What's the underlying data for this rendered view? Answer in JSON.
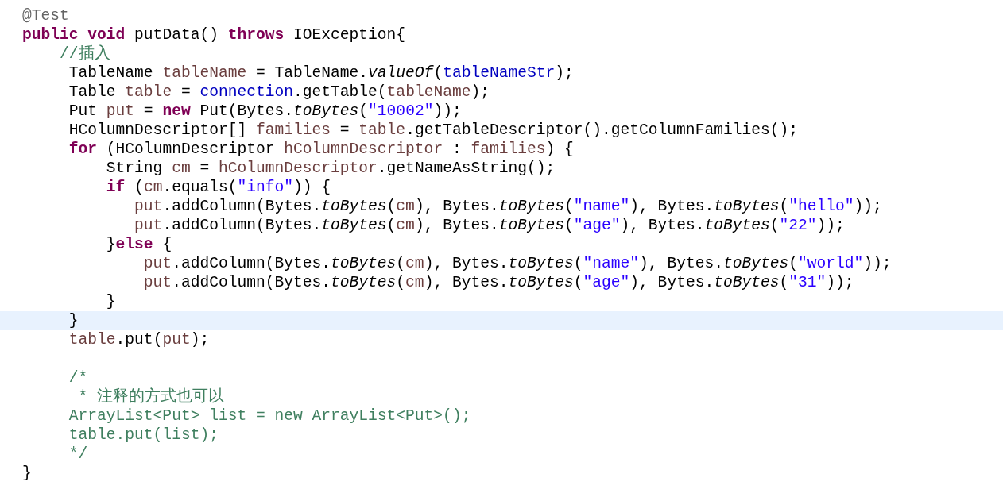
{
  "editor": {
    "lines": [
      {
        "highlighted": false,
        "tokens": [
          {
            "kind": "annotation",
            "text": "@Test"
          }
        ]
      },
      {
        "highlighted": false,
        "tokens": [
          {
            "kind": "keyword",
            "text": "public void"
          },
          {
            "kind": "plain",
            "text": " putData() "
          },
          {
            "kind": "keyword",
            "text": "throws"
          },
          {
            "kind": "plain",
            "text": " IOException{"
          }
        ]
      },
      {
        "highlighted": false,
        "tokens": [
          {
            "kind": "comment",
            "text": "    //插入"
          }
        ]
      },
      {
        "highlighted": false,
        "tokens": [
          {
            "kind": "plain",
            "text": "     TableName "
          },
          {
            "kind": "variable",
            "text": "tableName"
          },
          {
            "kind": "plain",
            "text": " = TableName."
          },
          {
            "kind": "static",
            "text": "valueOf"
          },
          {
            "kind": "plain",
            "text": "("
          },
          {
            "kind": "field",
            "text": "tableNameStr"
          },
          {
            "kind": "plain",
            "text": ");"
          }
        ]
      },
      {
        "highlighted": false,
        "tokens": [
          {
            "kind": "plain",
            "text": "     Table "
          },
          {
            "kind": "variable",
            "text": "table"
          },
          {
            "kind": "plain",
            "text": " = "
          },
          {
            "kind": "field",
            "text": "connection"
          },
          {
            "kind": "plain",
            "text": ".getTable("
          },
          {
            "kind": "variable",
            "text": "tableName"
          },
          {
            "kind": "plain",
            "text": ");"
          }
        ]
      },
      {
        "highlighted": false,
        "tokens": [
          {
            "kind": "plain",
            "text": "     Put "
          },
          {
            "kind": "variable",
            "text": "put"
          },
          {
            "kind": "plain",
            "text": " = "
          },
          {
            "kind": "keyword",
            "text": "new"
          },
          {
            "kind": "plain",
            "text": " Put(Bytes."
          },
          {
            "kind": "static",
            "text": "toBytes"
          },
          {
            "kind": "plain",
            "text": "("
          },
          {
            "kind": "string",
            "text": "\"10002\""
          },
          {
            "kind": "plain",
            "text": "));"
          }
        ]
      },
      {
        "highlighted": false,
        "tokens": [
          {
            "kind": "plain",
            "text": "     HColumnDescriptor[] "
          },
          {
            "kind": "variable",
            "text": "families"
          },
          {
            "kind": "plain",
            "text": " = "
          },
          {
            "kind": "variable",
            "text": "table"
          },
          {
            "kind": "plain",
            "text": ".getTableDescriptor().getColumnFamilies();"
          }
        ]
      },
      {
        "highlighted": false,
        "tokens": [
          {
            "kind": "keyword",
            "text": "     for"
          },
          {
            "kind": "plain",
            "text": " (HColumnDescriptor "
          },
          {
            "kind": "variable",
            "text": "hColumnDescriptor"
          },
          {
            "kind": "plain",
            "text": " : "
          },
          {
            "kind": "variable",
            "text": "families"
          },
          {
            "kind": "plain",
            "text": ") {"
          }
        ]
      },
      {
        "highlighted": false,
        "tokens": [
          {
            "kind": "plain",
            "text": "         String "
          },
          {
            "kind": "variable",
            "text": "cm"
          },
          {
            "kind": "plain",
            "text": " = "
          },
          {
            "kind": "variable",
            "text": "hColumnDescriptor"
          },
          {
            "kind": "plain",
            "text": ".getNameAsString();"
          }
        ]
      },
      {
        "highlighted": false,
        "tokens": [
          {
            "kind": "keyword",
            "text": "         if"
          },
          {
            "kind": "plain",
            "text": " ("
          },
          {
            "kind": "variable",
            "text": "cm"
          },
          {
            "kind": "plain",
            "text": ".equals("
          },
          {
            "kind": "string",
            "text": "\"info\""
          },
          {
            "kind": "plain",
            "text": ")) {"
          }
        ]
      },
      {
        "highlighted": false,
        "tokens": [
          {
            "kind": "variable",
            "text": "            put"
          },
          {
            "kind": "plain",
            "text": ".addColumn(Bytes."
          },
          {
            "kind": "static",
            "text": "toBytes"
          },
          {
            "kind": "plain",
            "text": "("
          },
          {
            "kind": "variable",
            "text": "cm"
          },
          {
            "kind": "plain",
            "text": "), Bytes."
          },
          {
            "kind": "static",
            "text": "toBytes"
          },
          {
            "kind": "plain",
            "text": "("
          },
          {
            "kind": "string",
            "text": "\"name\""
          },
          {
            "kind": "plain",
            "text": "), Bytes."
          },
          {
            "kind": "static",
            "text": "toBytes"
          },
          {
            "kind": "plain",
            "text": "("
          },
          {
            "kind": "string",
            "text": "\"hello\""
          },
          {
            "kind": "plain",
            "text": "));"
          }
        ]
      },
      {
        "highlighted": false,
        "tokens": [
          {
            "kind": "variable",
            "text": "            put"
          },
          {
            "kind": "plain",
            "text": ".addColumn(Bytes."
          },
          {
            "kind": "static",
            "text": "toBytes"
          },
          {
            "kind": "plain",
            "text": "("
          },
          {
            "kind": "variable",
            "text": "cm"
          },
          {
            "kind": "plain",
            "text": "), Bytes."
          },
          {
            "kind": "static",
            "text": "toBytes"
          },
          {
            "kind": "plain",
            "text": "("
          },
          {
            "kind": "string",
            "text": "\"age\""
          },
          {
            "kind": "plain",
            "text": "), Bytes."
          },
          {
            "kind": "static",
            "text": "toBytes"
          },
          {
            "kind": "plain",
            "text": "("
          },
          {
            "kind": "string",
            "text": "\"22\""
          },
          {
            "kind": "plain",
            "text": "));"
          }
        ]
      },
      {
        "highlighted": false,
        "tokens": [
          {
            "kind": "plain",
            "text": "         }"
          },
          {
            "kind": "keyword",
            "text": "else"
          },
          {
            "kind": "plain",
            "text": " {"
          }
        ]
      },
      {
        "highlighted": false,
        "tokens": [
          {
            "kind": "variable",
            "text": "             put"
          },
          {
            "kind": "plain",
            "text": ".addColumn(Bytes."
          },
          {
            "kind": "static",
            "text": "toBytes"
          },
          {
            "kind": "plain",
            "text": "("
          },
          {
            "kind": "variable",
            "text": "cm"
          },
          {
            "kind": "plain",
            "text": "), Bytes."
          },
          {
            "kind": "static",
            "text": "toBytes"
          },
          {
            "kind": "plain",
            "text": "("
          },
          {
            "kind": "string",
            "text": "\"name\""
          },
          {
            "kind": "plain",
            "text": "), Bytes."
          },
          {
            "kind": "static",
            "text": "toBytes"
          },
          {
            "kind": "plain",
            "text": "("
          },
          {
            "kind": "string",
            "text": "\"world\""
          },
          {
            "kind": "plain",
            "text": "));"
          }
        ]
      },
      {
        "highlighted": false,
        "tokens": [
          {
            "kind": "variable",
            "text": "             put"
          },
          {
            "kind": "plain",
            "text": ".addColumn(Bytes."
          },
          {
            "kind": "static",
            "text": "toBytes"
          },
          {
            "kind": "plain",
            "text": "("
          },
          {
            "kind": "variable",
            "text": "cm"
          },
          {
            "kind": "plain",
            "text": "), Bytes."
          },
          {
            "kind": "static",
            "text": "toBytes"
          },
          {
            "kind": "plain",
            "text": "("
          },
          {
            "kind": "string",
            "text": "\"age\""
          },
          {
            "kind": "plain",
            "text": "), Bytes."
          },
          {
            "kind": "static",
            "text": "toBytes"
          },
          {
            "kind": "plain",
            "text": "("
          },
          {
            "kind": "string",
            "text": "\"31\""
          },
          {
            "kind": "plain",
            "text": "));"
          }
        ]
      },
      {
        "highlighted": false,
        "tokens": [
          {
            "kind": "plain",
            "text": "         }"
          }
        ]
      },
      {
        "highlighted": true,
        "tokens": [
          {
            "kind": "plain",
            "text": "     }"
          }
        ]
      },
      {
        "highlighted": false,
        "tokens": [
          {
            "kind": "variable",
            "text": "     table"
          },
          {
            "kind": "plain",
            "text": ".put("
          },
          {
            "kind": "variable",
            "text": "put"
          },
          {
            "kind": "plain",
            "text": ");"
          }
        ]
      },
      {
        "highlighted": false
      },
      {
        "highlighted": false,
        "tokens": [
          {
            "kind": "comment",
            "text": "     /*"
          }
        ]
      },
      {
        "highlighted": false,
        "tokens": [
          {
            "kind": "comment",
            "text": "      * 注释的方式也可以"
          }
        ]
      },
      {
        "highlighted": false,
        "tokens": [
          {
            "kind": "comment",
            "text": "     ArrayList<Put> list = new ArrayList<Put>();"
          }
        ]
      },
      {
        "highlighted": false,
        "tokens": [
          {
            "kind": "comment",
            "text": "     table.put(list);"
          }
        ]
      },
      {
        "highlighted": false,
        "tokens": [
          {
            "kind": "comment",
            "text": "     */"
          }
        ]
      },
      {
        "highlighted": false,
        "tokens": [
          {
            "kind": "plain",
            "text": "}"
          }
        ]
      }
    ]
  }
}
